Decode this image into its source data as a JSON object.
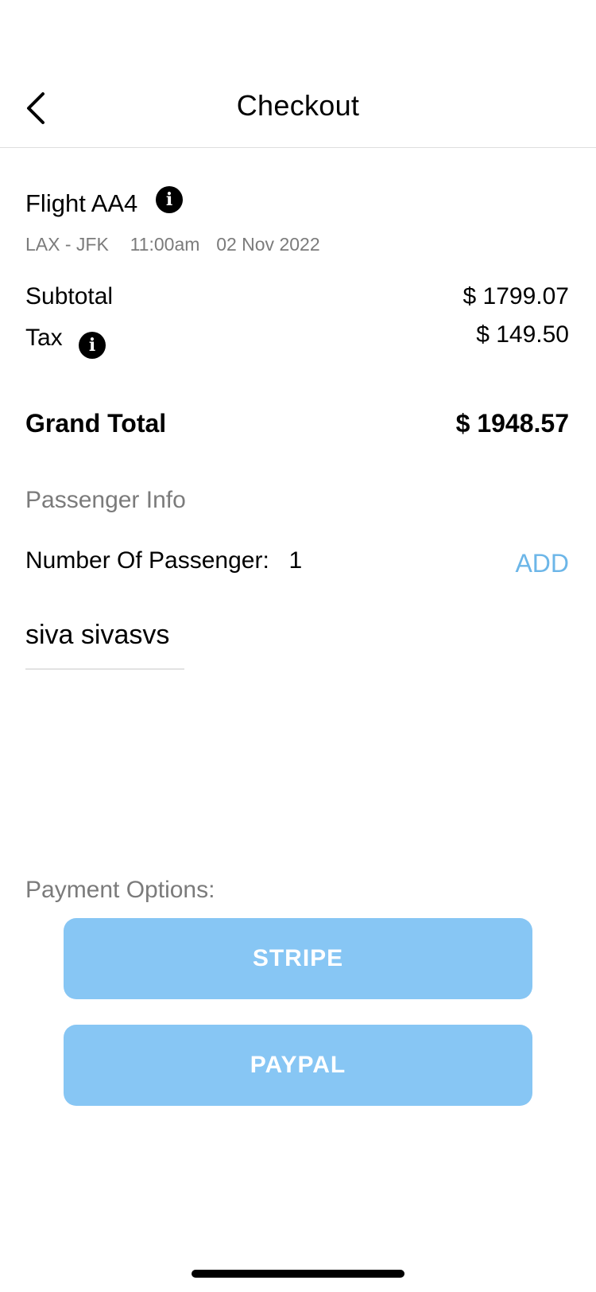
{
  "header": {
    "title": "Checkout"
  },
  "flight": {
    "title": "Flight AA4",
    "route": "LAX - JFK",
    "time": "11:00am",
    "date": "02 Nov 2022",
    "info_icon": "info-circle-icon"
  },
  "pricing": {
    "subtotal_label": "Subtotal",
    "subtotal_value": "$ 1799.07",
    "tax_label": "Tax",
    "tax_value": "$ 149.50",
    "grand_total_label": "Grand Total",
    "grand_total_value": "$ 1948.57"
  },
  "passengers": {
    "section_label": "Passenger Info",
    "count_label": "Number Of Passenger:",
    "count_value": "1",
    "add_label": "ADD",
    "names": [
      "siva sivasvs"
    ]
  },
  "payment": {
    "section_label": "Payment Options:",
    "stripe_label": "STRIPE",
    "paypal_label": "PAYPAL"
  },
  "colors": {
    "accent": "#87c6f4",
    "link": "#6cb6e8",
    "muted_text": "#7b7b7b"
  }
}
